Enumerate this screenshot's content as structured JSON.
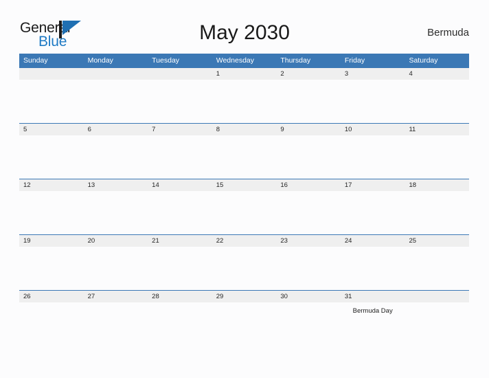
{
  "brand": {
    "name_part1": "General",
    "name_part2": "Blue",
    "mark_icon": "blue-triangle-flag-icon",
    "accent_color": "#1f7ac4"
  },
  "header": {
    "title": "May 2030",
    "locale": "Bermuda"
  },
  "theme": {
    "header_blue": "#3b78b5",
    "date_band_gray": "#efefef",
    "page_background": "#fcfcfd",
    "text_color": "#242424"
  },
  "calendar": {
    "month": "May",
    "year": "2030",
    "weekday_headers": [
      "Sunday",
      "Monday",
      "Tuesday",
      "Wednesday",
      "Thursday",
      "Friday",
      "Saturday"
    ],
    "weeks": [
      {
        "days": [
          {
            "num": "",
            "event": ""
          },
          {
            "num": "",
            "event": ""
          },
          {
            "num": "",
            "event": ""
          },
          {
            "num": "1",
            "event": ""
          },
          {
            "num": "2",
            "event": ""
          },
          {
            "num": "3",
            "event": ""
          },
          {
            "num": "4",
            "event": ""
          }
        ]
      },
      {
        "days": [
          {
            "num": "5",
            "event": ""
          },
          {
            "num": "6",
            "event": ""
          },
          {
            "num": "7",
            "event": ""
          },
          {
            "num": "8",
            "event": ""
          },
          {
            "num": "9",
            "event": ""
          },
          {
            "num": "10",
            "event": ""
          },
          {
            "num": "11",
            "event": ""
          }
        ]
      },
      {
        "days": [
          {
            "num": "12",
            "event": ""
          },
          {
            "num": "13",
            "event": ""
          },
          {
            "num": "14",
            "event": ""
          },
          {
            "num": "15",
            "event": ""
          },
          {
            "num": "16",
            "event": ""
          },
          {
            "num": "17",
            "event": ""
          },
          {
            "num": "18",
            "event": ""
          }
        ]
      },
      {
        "days": [
          {
            "num": "19",
            "event": ""
          },
          {
            "num": "20",
            "event": ""
          },
          {
            "num": "21",
            "event": ""
          },
          {
            "num": "22",
            "event": ""
          },
          {
            "num": "23",
            "event": ""
          },
          {
            "num": "24",
            "event": ""
          },
          {
            "num": "25",
            "event": ""
          }
        ]
      },
      {
        "days": [
          {
            "num": "26",
            "event": ""
          },
          {
            "num": "27",
            "event": ""
          },
          {
            "num": "28",
            "event": ""
          },
          {
            "num": "29",
            "event": ""
          },
          {
            "num": "30",
            "event": ""
          },
          {
            "num": "31",
            "event": "Bermuda Day"
          },
          {
            "num": "",
            "event": ""
          }
        ]
      }
    ]
  }
}
